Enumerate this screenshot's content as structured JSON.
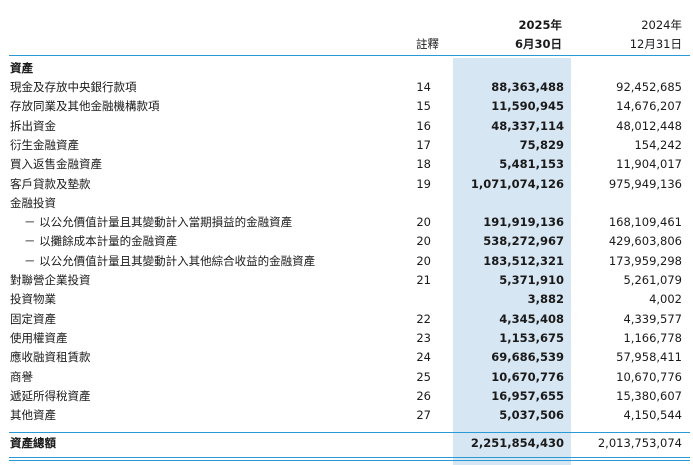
{
  "header": {
    "note_col": "註釋",
    "cur_year": "2025年",
    "cur_date": "6月30日",
    "prev_year": "2024年",
    "prev_date": "12月31日"
  },
  "section_title": "資產",
  "rows": [
    {
      "label": "現金及存放中央銀行款項",
      "note": "14",
      "cur": "88,363,488",
      "prev": "92,452,685",
      "indent": false
    },
    {
      "label": "存放同業及其他金融機構款項",
      "note": "15",
      "cur": "11,590,945",
      "prev": "14,676,207",
      "indent": false
    },
    {
      "label": "拆出資金",
      "note": "16",
      "cur": "48,337,114",
      "prev": "48,012,448",
      "indent": false
    },
    {
      "label": "衍生金融資產",
      "note": "17",
      "cur": "75,829",
      "prev": "154,242",
      "indent": false
    },
    {
      "label": "買入返售金融資產",
      "note": "18",
      "cur": "5,481,153",
      "prev": "11,904,017",
      "indent": false
    },
    {
      "label": "客戶貸款及墊款",
      "note": "19",
      "cur": "1,071,074,126",
      "prev": "975,949,136",
      "indent": false
    },
    {
      "label": "金融投資",
      "note": "",
      "cur": "",
      "prev": "",
      "indent": false
    },
    {
      "label": "－ 以公允價值計量且其變動計入當期損益的金融資產",
      "note": "20",
      "cur": "191,919,136",
      "prev": "168,109,461",
      "indent": true
    },
    {
      "label": "－ 以攤餘成本計量的金融資產",
      "note": "20",
      "cur": "538,272,967",
      "prev": "429,603,806",
      "indent": true
    },
    {
      "label": "－ 以公允價值計量且其變動計入其他綜合收益的金融資產",
      "note": "20",
      "cur": "183,512,321",
      "prev": "173,959,298",
      "indent": true
    },
    {
      "label": "對聯營企業投資",
      "note": "21",
      "cur": "5,371,910",
      "prev": "5,261,079",
      "indent": false
    },
    {
      "label": "投資物業",
      "note": "",
      "cur": "3,882",
      "prev": "4,002",
      "indent": false
    },
    {
      "label": "固定資產",
      "note": "22",
      "cur": "4,345,408",
      "prev": "4,339,577",
      "indent": false
    },
    {
      "label": "使用權資產",
      "note": "23",
      "cur": "1,153,675",
      "prev": "1,166,778",
      "indent": false
    },
    {
      "label": "應收融資租賃款",
      "note": "24",
      "cur": "69,686,539",
      "prev": "57,958,411",
      "indent": false
    },
    {
      "label": "商譽",
      "note": "25",
      "cur": "10,670,776",
      "prev": "10,670,776",
      "indent": false
    },
    {
      "label": "遞延所得稅資產",
      "note": "26",
      "cur": "16,957,655",
      "prev": "15,380,607",
      "indent": false
    },
    {
      "label": "其他資產",
      "note": "27",
      "cur": "5,037,506",
      "prev": "4,150,544",
      "indent": false
    }
  ],
  "total": {
    "label": "資產總額",
    "cur": "2,251,854,430",
    "prev": "2,013,753,074"
  }
}
